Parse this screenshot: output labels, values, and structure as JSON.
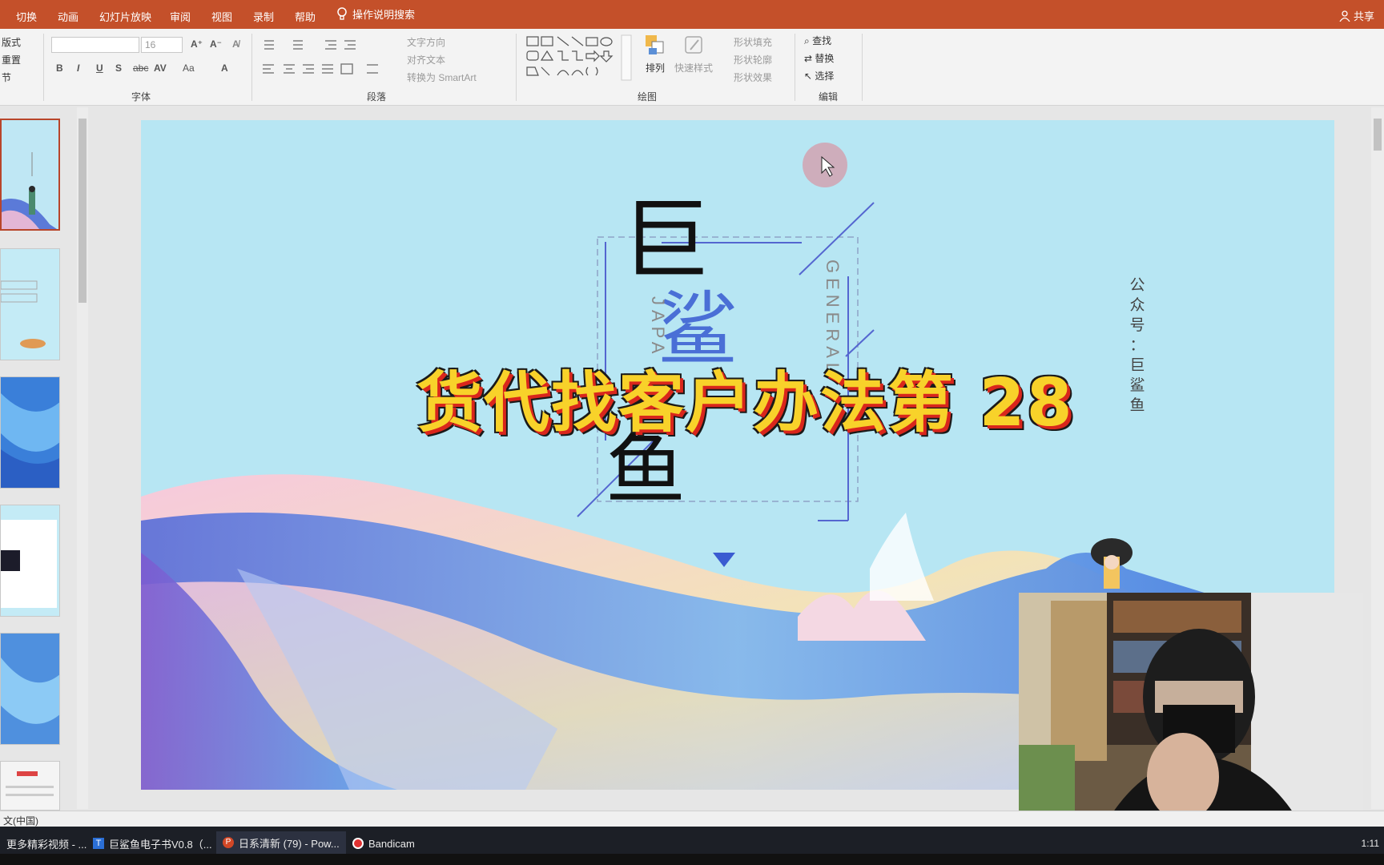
{
  "menu": {
    "tabs": [
      "切换",
      "动画",
      "幻灯片放映",
      "审阅",
      "视图",
      "录制",
      "帮助"
    ],
    "tell_me": "操作说明搜索",
    "share": "共享"
  },
  "ribbon": {
    "slides_group": {
      "layout": "版式",
      "reset": "重置",
      "section": "节"
    },
    "font_group": {
      "label": "字体",
      "font_size": "16"
    },
    "paragraph_group": {
      "label": "段落",
      "text_direction": "文字方向",
      "align_text": "对齐文本",
      "smartart": "转换为 SmartArt"
    },
    "drawing_group": {
      "label": "绘图",
      "arrange": "排列",
      "quick_styles": "快速样式",
      "shape_fill": "形状填充",
      "shape_outline": "形状轮廓",
      "shape_effects": "形状效果"
    },
    "editing_group": {
      "label": "编辑",
      "find": "查找",
      "replace": "替换",
      "select": "选择"
    }
  },
  "slide": {
    "title_chars": [
      "巨",
      "鲨",
      "鱼"
    ],
    "vertical_left": "JAPA",
    "vertical_right": "GENERAL",
    "side_text": [
      "公",
      "众",
      "号",
      "：",
      "巨",
      "鲨",
      "鱼"
    ]
  },
  "overlay_caption": "货代找客户办法第 28",
  "status": {
    "language": "文(中国)"
  },
  "taskbar": {
    "items": [
      {
        "label": "更多精彩视频 - ..."
      },
      {
        "label": "巨鲨鱼电子书V0.8（..."
      },
      {
        "label": "日系清新 (79) - Pow..."
      },
      {
        "label": "Bandicam"
      }
    ],
    "clock": "1:11"
  },
  "colors": {
    "menubar": "#c4502a",
    "slide_bg": "#b7e6f3",
    "accent_blue": "#4a6fd6",
    "caption_yellow": "#f8d22a",
    "caption_red": "#d9261c"
  }
}
